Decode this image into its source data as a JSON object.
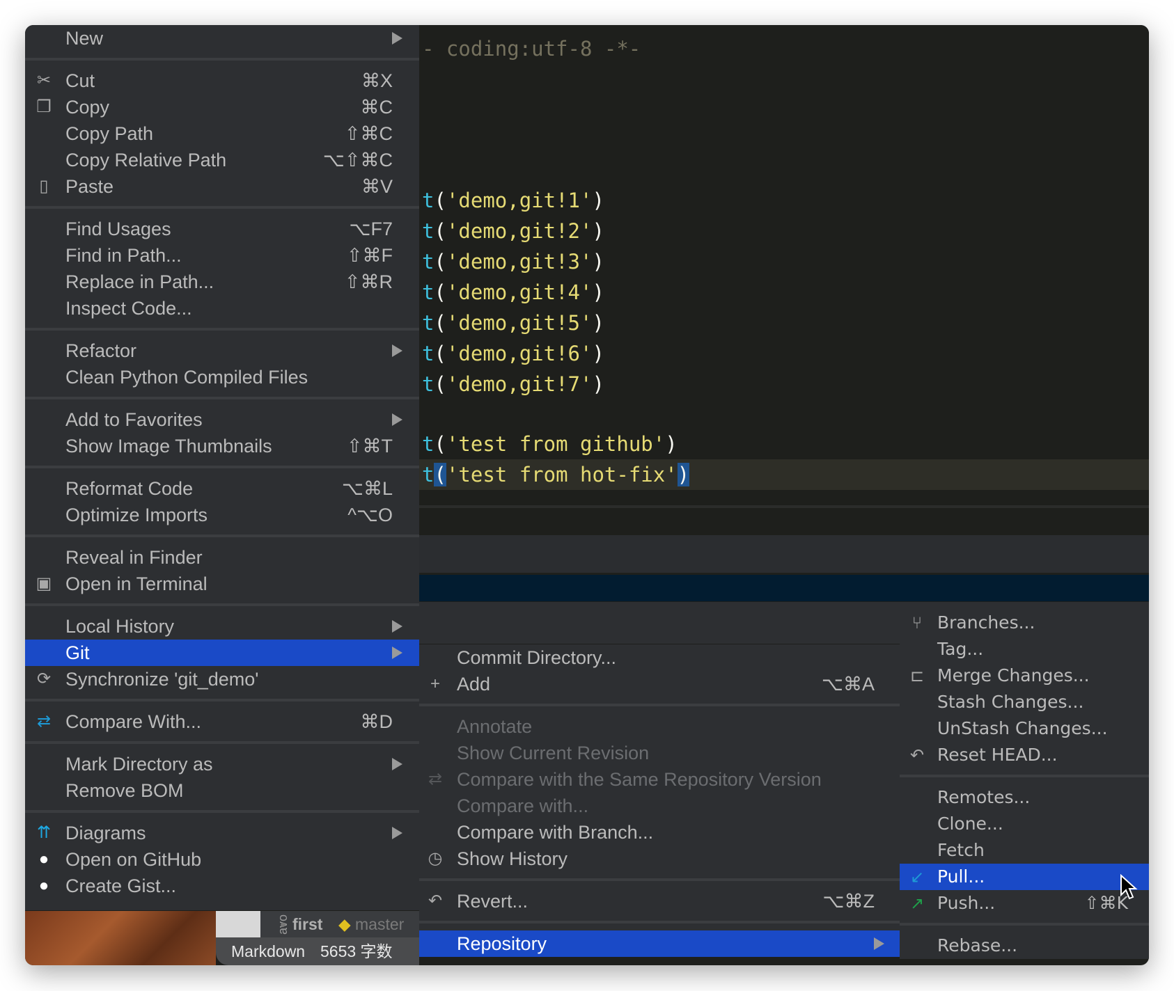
{
  "editor": {
    "lines": [
      [
        {
          "t": "- coding:utf-8 -*-",
          "c": "tk-cm"
        }
      ],
      [
        {
          "t": "t",
          "c": "tk-fn"
        },
        {
          "t": "(",
          "c": "tk-p"
        },
        {
          "t": "'demo,git!1'",
          "c": "tk-str"
        },
        {
          "t": ")",
          "c": "tk-p"
        }
      ],
      [
        {
          "t": "t",
          "c": "tk-fn"
        },
        {
          "t": "(",
          "c": "tk-p"
        },
        {
          "t": "'demo,git!2'",
          "c": "tk-str"
        },
        {
          "t": ")",
          "c": "tk-p"
        }
      ],
      [
        {
          "t": "t",
          "c": "tk-fn"
        },
        {
          "t": "(",
          "c": "tk-p"
        },
        {
          "t": "'demo,git!3'",
          "c": "tk-str"
        },
        {
          "t": ")",
          "c": "tk-p"
        }
      ],
      [
        {
          "t": "t",
          "c": "tk-fn"
        },
        {
          "t": "(",
          "c": "tk-p"
        },
        {
          "t": "'demo,git!4'",
          "c": "tk-str"
        },
        {
          "t": ")",
          "c": "tk-p"
        }
      ],
      [
        {
          "t": "t",
          "c": "tk-fn"
        },
        {
          "t": "(",
          "c": "tk-p"
        },
        {
          "t": "'demo,git!5'",
          "c": "tk-str"
        },
        {
          "t": ")",
          "c": "tk-p"
        }
      ],
      [
        {
          "t": "t",
          "c": "tk-fn"
        },
        {
          "t": "(",
          "c": "tk-p"
        },
        {
          "t": "'demo,git!6'",
          "c": "tk-str"
        },
        {
          "t": ")",
          "c": "tk-p"
        }
      ],
      [
        {
          "t": "t",
          "c": "tk-fn"
        },
        {
          "t": "(",
          "c": "tk-p"
        },
        {
          "t": "'demo,git!7'",
          "c": "tk-str"
        },
        {
          "t": ")",
          "c": "tk-p"
        }
      ],
      [
        {
          "t": "t",
          "c": "tk-fn"
        },
        {
          "t": "(",
          "c": "tk-p"
        },
        {
          "t": "'test from github'",
          "c": "tk-str"
        },
        {
          "t": ")",
          "c": "tk-p"
        }
      ],
      [
        {
          "t": "t",
          "c": "tk-fn"
        },
        {
          "t": "(",
          "c": "tk-p tk-hl"
        },
        {
          "t": "'test from hot-fix'",
          "c": "tk-str"
        },
        {
          "t": ")",
          "c": "tk-p tk-hl"
        }
      ]
    ]
  },
  "status": {
    "tag1": "first",
    "tag2": "master",
    "side": "avo",
    "mode": "Markdown",
    "count": "5653 字数"
  },
  "main_menu": [
    {
      "label": "New",
      "submenu": true
    },
    {
      "sep": true
    },
    {
      "label": "Cut",
      "shortcut": "⌘X",
      "icon": "scissors-icon",
      "glyph": "✂"
    },
    {
      "label": "Copy",
      "shortcut": "⌘C",
      "icon": "copy-icon",
      "glyph": "❐"
    },
    {
      "label": "Copy Path",
      "shortcut": "⇧⌘C"
    },
    {
      "label": "Copy Relative Path",
      "shortcut": "⌥⇧⌘C"
    },
    {
      "label": "Paste",
      "shortcut": "⌘V",
      "icon": "clipboard-icon",
      "glyph": "▯"
    },
    {
      "sep": true
    },
    {
      "label": "Find Usages",
      "shortcut": "⌥F7"
    },
    {
      "label": "Find in Path...",
      "shortcut": "⇧⌘F"
    },
    {
      "label": "Replace in Path...",
      "shortcut": "⇧⌘R"
    },
    {
      "label": "Inspect Code..."
    },
    {
      "sep": true
    },
    {
      "label": "Refactor",
      "submenu": true
    },
    {
      "label": "Clean Python Compiled Files"
    },
    {
      "sep": true
    },
    {
      "label": "Add to Favorites",
      "submenu": true
    },
    {
      "label": "Show Image Thumbnails",
      "shortcut": "⇧⌘T"
    },
    {
      "sep": true
    },
    {
      "label": "Reformat Code",
      "shortcut": "⌥⌘L"
    },
    {
      "label": "Optimize Imports",
      "shortcut": "^⌥O"
    },
    {
      "sep": true
    },
    {
      "label": "Reveal in Finder"
    },
    {
      "label": "Open in Terminal",
      "icon": "terminal-icon",
      "glyph": "▣"
    },
    {
      "sep": true
    },
    {
      "label": "Local History",
      "submenu": true
    },
    {
      "label": "Git",
      "submenu": true,
      "highlighted": true
    },
    {
      "label": "Synchronize 'git_demo'",
      "icon": "sync-icon",
      "glyph": "⟳"
    },
    {
      "sep": true
    },
    {
      "label": "Compare With...",
      "shortcut": "⌘D",
      "icon": "compare-icon",
      "glyph": "⇄",
      "color": "#1e9ad6"
    },
    {
      "sep": true
    },
    {
      "label": "Mark Directory as",
      "submenu": true
    },
    {
      "label": "Remove BOM"
    },
    {
      "sep": true
    },
    {
      "label": "Diagrams",
      "submenu": true,
      "icon": "diagram-icon",
      "glyph": "⇈",
      "color": "#1ea7e0"
    },
    {
      "label": "Open on GitHub",
      "icon": "github-icon",
      "glyph": "●",
      "color": "#ffffff"
    },
    {
      "label": "Create Gist...",
      "icon": "github-icon",
      "glyph": "●",
      "color": "#ffffff"
    }
  ],
  "git_menu": [
    {
      "label": "Commit Directory..."
    },
    {
      "label": "Add",
      "shortcut": "⌥⌘A",
      "icon": "plus-icon",
      "glyph": "+"
    },
    {
      "sep": true
    },
    {
      "label": "Annotate",
      "disabled": true
    },
    {
      "label": "Show Current Revision",
      "disabled": true
    },
    {
      "label": "Compare with the Same Repository Version",
      "disabled": true,
      "icon": "compare-icon",
      "glyph": "⇄"
    },
    {
      "label": "Compare with...",
      "disabled": true
    },
    {
      "label": "Compare with Branch..."
    },
    {
      "label": "Show History",
      "icon": "clock-icon",
      "glyph": "◷"
    },
    {
      "sep": true
    },
    {
      "label": "Revert...",
      "shortcut": "⌥⌘Z",
      "icon": "revert-icon",
      "glyph": "↶"
    },
    {
      "sep": true
    },
    {
      "label": "Repository",
      "submenu": true,
      "highlighted": true
    }
  ],
  "repo_menu": [
    {
      "label": "Branches...",
      "icon": "branch-icon",
      "glyph": "⑂"
    },
    {
      "label": "Tag..."
    },
    {
      "label": "Merge Changes...",
      "icon": "merge-icon",
      "glyph": "⊏"
    },
    {
      "label": "Stash Changes..."
    },
    {
      "label": "UnStash Changes..."
    },
    {
      "label": "Reset HEAD...",
      "icon": "reset-icon",
      "glyph": "↶"
    },
    {
      "sep": true
    },
    {
      "label": "Remotes..."
    },
    {
      "label": "Clone..."
    },
    {
      "label": "Fetch"
    },
    {
      "label": "Pull...",
      "highlighted": true,
      "icon": "pull-arrow-icon",
      "glyph": "↙",
      "color": "#1e9ad6"
    },
    {
      "label": "Push...",
      "shortcut": "⇧⌘K",
      "icon": "push-arrow-icon",
      "glyph": "↗",
      "color": "#1fa04a"
    },
    {
      "sep": true
    },
    {
      "label": "Rebase..."
    }
  ],
  "colors": {
    "highlight": "#1a4ac7",
    "menu_bg": "#2d2f32",
    "editor_bg": "#1e1f1c"
  }
}
